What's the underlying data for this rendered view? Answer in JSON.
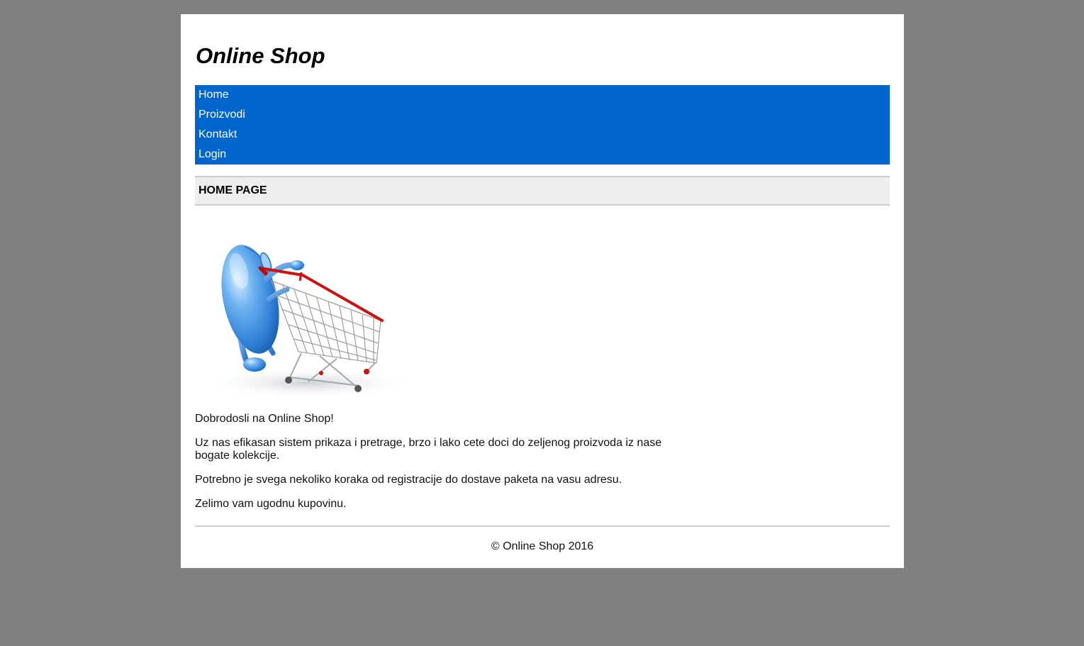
{
  "site": {
    "title": "Online Shop"
  },
  "nav": {
    "items": [
      {
        "label": "Home"
      },
      {
        "label": "Proizvodi"
      },
      {
        "label": "Kontakt"
      },
      {
        "label": "Login"
      }
    ]
  },
  "main": {
    "heading": "HOME PAGE",
    "hero_image": "mouse-pushing-shopping-cart-illustration",
    "paragraphs": [
      "Dobrodosli na Online Shop!",
      "Uz nas efikasan sistem prikaza i pretrage, brzo i lako cete doci do zeljenog proizvoda iz nase bogate kolekcije.",
      "Potrebno je svega nekoliko koraka od registracije do dostave paketa na vasu adresu.",
      "Zelimo vam ugodnu kupovinu."
    ]
  },
  "footer": {
    "text": "© Online Shop 2016"
  },
  "colors": {
    "background": "#808080",
    "nav": "#0066cc",
    "heading_bar": "#eeeeee",
    "cart_red": "#cc1111",
    "mouse_blue": "#3a8de0"
  }
}
